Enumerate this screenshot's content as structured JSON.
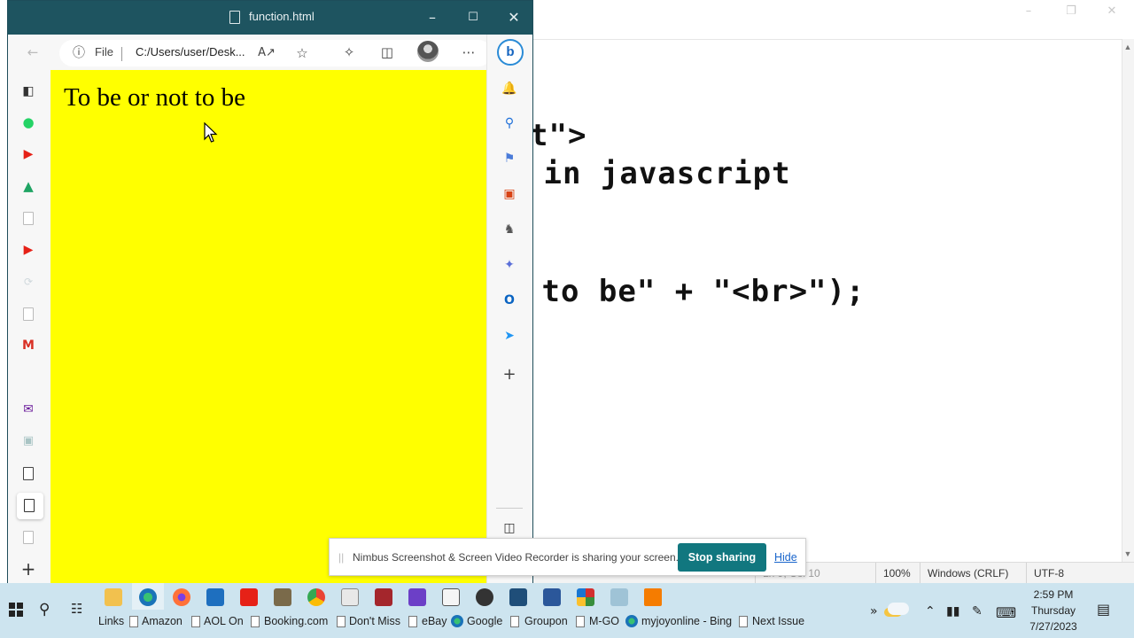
{
  "editor": {
    "code_lines": [
      "t\">",
      " in javascript",
      " to be\" + \"<br>\");"
    ],
    "status": {
      "position": "Ln 9, Col 10",
      "zoom": "100%",
      "line_ending": "Windows (CRLF)",
      "encoding": "UTF-8"
    }
  },
  "browser": {
    "title": "function.html",
    "address": {
      "scheme_label": "File",
      "url": "C:/Users/user/Desk..."
    },
    "page_text": "To be or not to be",
    "page_background": "#ffff00"
  },
  "share_bar": {
    "message": "Nimbus Screenshot & Screen Video Recorder is sharing your screen.",
    "stop_label": "Stop sharing",
    "hide_label": "Hide"
  },
  "taskbar": {
    "links_label": "Links",
    "bookmarks": [
      "Amazon",
      "AOL On",
      "Booking.com",
      "Don't Miss",
      "eBay",
      "Google",
      "Groupon",
      "M-GO",
      "myjoyonline - Bing",
      "Next Issue"
    ],
    "clock": {
      "time": "2:59 PM",
      "day": "Thursday",
      "date": "7/27/2023"
    }
  },
  "colors": {
    "accent": "#1e5460",
    "share_button": "#11777f",
    "taskbar": "#cde4ef"
  }
}
